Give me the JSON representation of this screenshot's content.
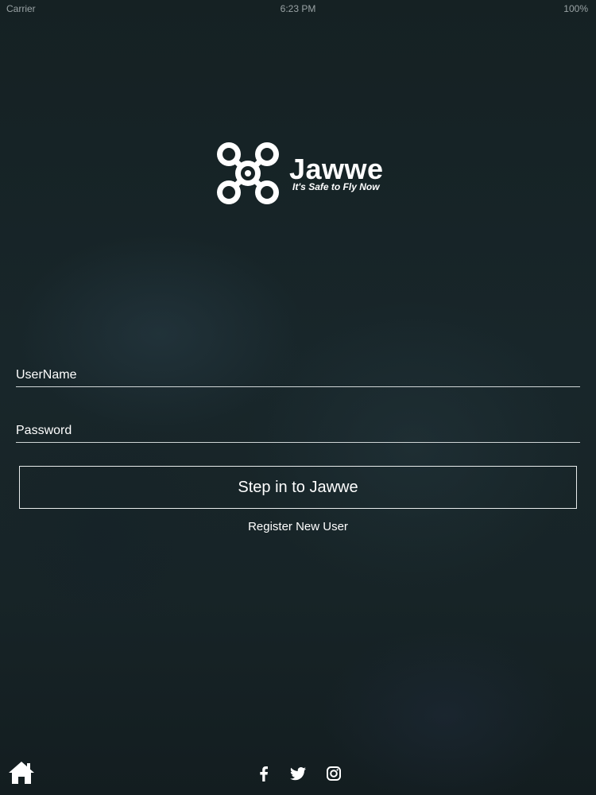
{
  "status_bar": {
    "carrier": "Carrier",
    "time": "6:23 PM",
    "battery": "100%"
  },
  "brand": {
    "name": "Jawwe",
    "tagline": "It's Safe to Fly Now",
    "logo_icon": "drone-icon"
  },
  "login_form": {
    "username_placeholder": "UserName",
    "password_placeholder": "Password",
    "submit_label": "Step in to Jawwe",
    "register_label": "Register New User"
  },
  "footer": {
    "home_icon": "home-icon",
    "social_icons": [
      "facebook-icon",
      "twitter-icon",
      "instagram-icon"
    ]
  },
  "colors": {
    "background": "#162224",
    "text": "#ffffff",
    "divider": "#cfd5d6"
  }
}
